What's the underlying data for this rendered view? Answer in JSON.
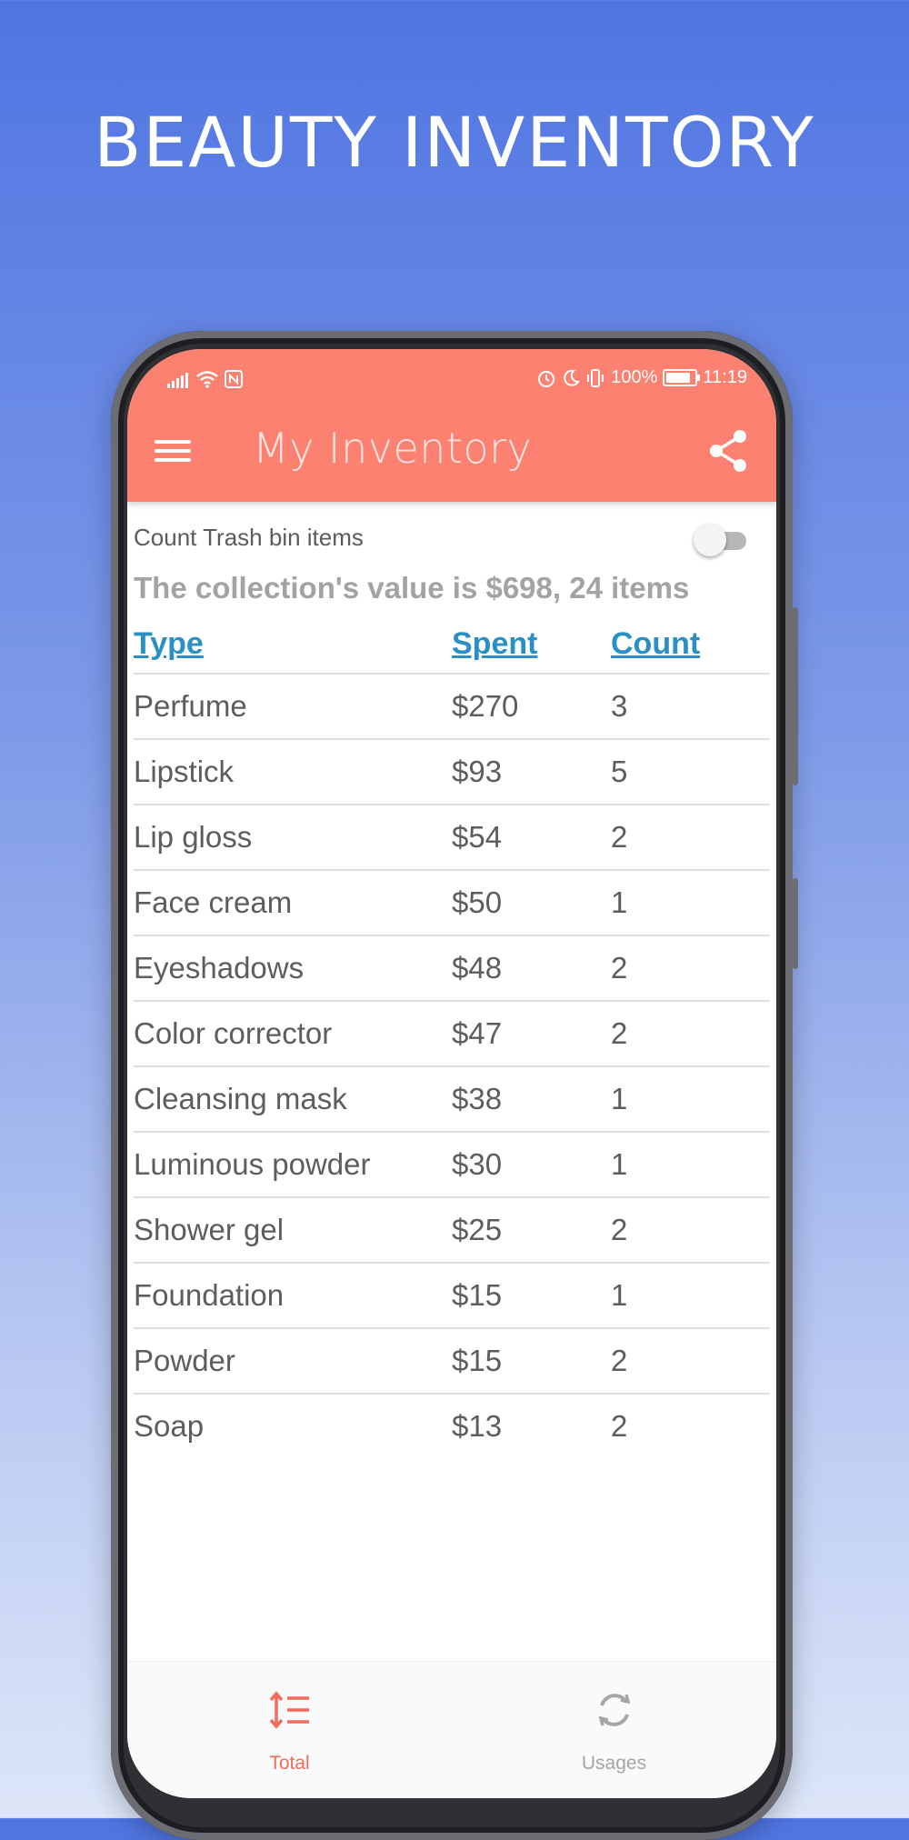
{
  "promo": {
    "title": "BEAUTY INVENTORY"
  },
  "status_bar": {
    "alarm_icon": "alarm-icon",
    "moon_icon": "moon-icon",
    "vibrate_icon": "vibrate-icon",
    "battery_percent": "100%",
    "battery_level": 1.0,
    "time": "11:19"
  },
  "appbar": {
    "title": "My Inventory",
    "menu_icon": "hamburger-menu-icon",
    "share_icon": "share-icon",
    "color": "#fc8170"
  },
  "trash_toggle": {
    "label": "Count Trash bin items",
    "on": false
  },
  "summary": "The collection's value is $698, 24 items",
  "table": {
    "headers": {
      "type": "Type",
      "spent": "Spent",
      "count": "Count"
    },
    "header_color": "#2a8fc4",
    "rows": [
      {
        "type": "Perfume",
        "spent": "$270",
        "count": "3"
      },
      {
        "type": "Lipstick",
        "spent": "$93",
        "count": "5"
      },
      {
        "type": "Lip gloss",
        "spent": "$54",
        "count": "2"
      },
      {
        "type": "Face cream",
        "spent": "$50",
        "count": "1"
      },
      {
        "type": "Eyeshadows",
        "spent": "$48",
        "count": "2"
      },
      {
        "type": "Color corrector",
        "spent": "$47",
        "count": "2"
      },
      {
        "type": "Cleansing mask",
        "spent": "$38",
        "count": "1"
      },
      {
        "type": "Luminous powder",
        "spent": "$30",
        "count": "1"
      },
      {
        "type": "Shower gel",
        "spent": "$25",
        "count": "2"
      },
      {
        "type": "Foundation",
        "spent": "$15",
        "count": "1"
      },
      {
        "type": "Powder",
        "spent": "$15",
        "count": "2"
      },
      {
        "type": "Soap",
        "spent": "$13",
        "count": "2"
      }
    ]
  },
  "bottom_nav": {
    "items": [
      {
        "label": "Total",
        "icon": "sort-list-icon",
        "active": true,
        "color": "#f26b5b"
      },
      {
        "label": "Usages",
        "icon": "sync-icon",
        "active": false,
        "color": "#a6a6a6"
      }
    ]
  }
}
